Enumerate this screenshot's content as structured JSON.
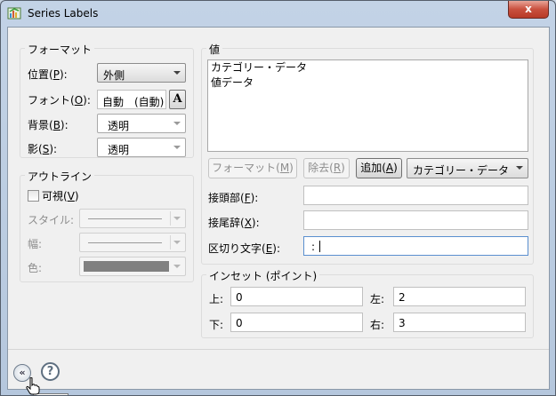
{
  "window": {
    "title": "Series Labels",
    "close_glyph": "x"
  },
  "format_group": {
    "legend": "フォーマット",
    "position": {
      "label": "位置(",
      "key": "P",
      "tail": "):",
      "value": "外側"
    },
    "font": {
      "label": "フォント(",
      "key": "O",
      "tail": "):",
      "value": "自動　(自動)",
      "icon_glyph": "A"
    },
    "background": {
      "label": "背景(",
      "key": "B",
      "tail": "):",
      "value": "透明"
    },
    "shadow": {
      "label": "影(",
      "key": "S",
      "tail": "):",
      "value": "透明"
    }
  },
  "outline_group": {
    "legend": "アウトライン",
    "visible": {
      "label": "可視(",
      "key": "V",
      "tail": ")",
      "checked": false
    },
    "style_label": "スタイル:",
    "width_label": "幅:",
    "color_label": "色:",
    "color_swatch": "#808080"
  },
  "values_group": {
    "legend": "値",
    "items": [
      "カテゴリー・データ",
      "値データ"
    ],
    "format_button": {
      "label": "フォーマット(",
      "key": "M",
      "tail": ")"
    },
    "remove_button": {
      "label": "除去(",
      "key": "R",
      "tail": ")"
    },
    "add_button": {
      "label": "追加(",
      "key": "A",
      "tail": ")"
    },
    "add_select_value": "カテゴリー・データ",
    "prefix": {
      "label": "接頭部(",
      "key": "F",
      "tail": "):",
      "value": ""
    },
    "suffix": {
      "label": "接尾辞(",
      "key": "X",
      "tail": "):",
      "value": ""
    },
    "separator": {
      "label": "区切り文字(",
      "key": "E",
      "tail": "):",
      "value": ":"
    }
  },
  "inset_group": {
    "legend": "インセット (ポイント)",
    "top": {
      "label": "上:",
      "value": "0"
    },
    "left": {
      "label": "左:",
      "value": "2"
    },
    "bottom": {
      "label": "下:",
      "value": "0"
    },
    "right": {
      "label": "右:",
      "value": "3"
    }
  },
  "footer": {
    "collapse_glyph": "«",
    "help_glyph": "?"
  },
  "colors": {
    "accent": "#5a8fcf",
    "close": "#c9503e"
  }
}
